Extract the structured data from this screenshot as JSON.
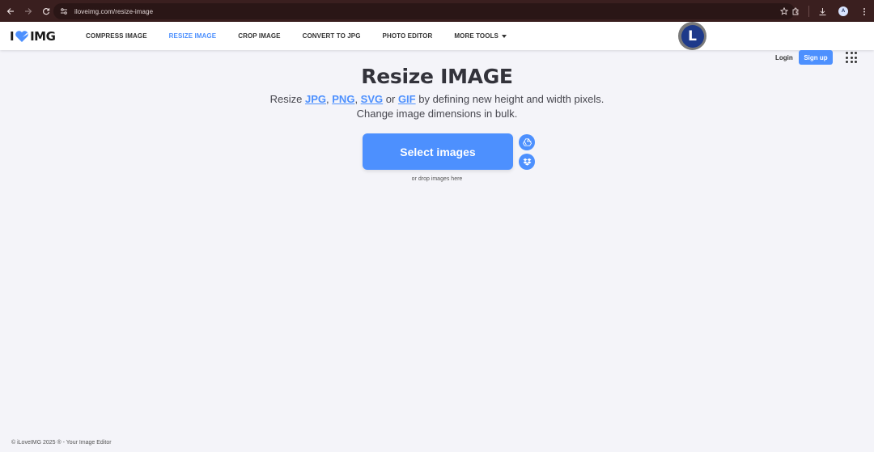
{
  "browser": {
    "url": "iloveimg.com/resize-image",
    "profile_initial": "A"
  },
  "header": {
    "logo_left": "I",
    "logo_right": "IMG",
    "nav": [
      {
        "label": "COMPRESS IMAGE"
      },
      {
        "label": "RESIZE IMAGE"
      },
      {
        "label": "CROP IMAGE"
      },
      {
        "label": "CONVERT TO JPG"
      },
      {
        "label": "PHOTO EDITOR"
      },
      {
        "label": "MORE TOOLS"
      }
    ],
    "badge_letter": "L",
    "login": "Login",
    "signup": "Sign up"
  },
  "main": {
    "title": "Resize IMAGE",
    "subtitle_prefix": "Resize ",
    "formats": [
      "JPG",
      "PNG",
      "SVG",
      "GIF"
    ],
    "subtitle_sep1": ", ",
    "subtitle_sep2": ", ",
    "subtitle_or": " or ",
    "subtitle_suffix": " by defining new height and width pixels.",
    "subtitle_line2": "Change image dimensions in bulk.",
    "select_button": "Select images",
    "drop_hint": "or drop images here"
  },
  "footer": {
    "text": "© iLoveIMG 2025 ® - Your Image Editor"
  },
  "colors": {
    "accent": "#4d90fe",
    "chrome": "#3a1f1f"
  }
}
